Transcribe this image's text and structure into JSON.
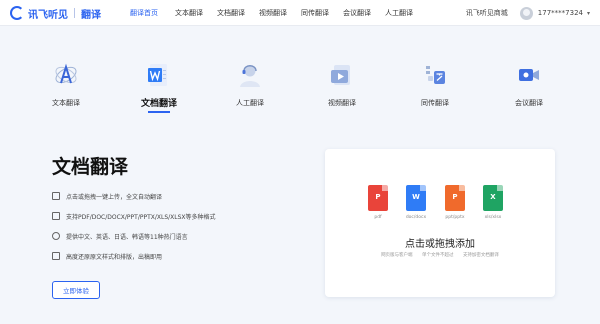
{
  "brand": {
    "name": "讯飞听见",
    "product": "翻译"
  },
  "nav": {
    "items": [
      {
        "label": "翻译首页",
        "active": true
      },
      {
        "label": "文本翻译",
        "active": false
      },
      {
        "label": "文档翻译",
        "active": false
      },
      {
        "label": "视频翻译",
        "active": false
      },
      {
        "label": "同传翻译",
        "active": false
      },
      {
        "label": "会议翻译",
        "active": false
      },
      {
        "label": "人工翻译",
        "active": false
      }
    ],
    "store_link": "讯飞听见商城",
    "username": "177****7324"
  },
  "feature_tabs": [
    {
      "label": "文本翻译",
      "icon": "text-translate-icon",
      "active": false
    },
    {
      "label": "文档翻译",
      "icon": "word-document-icon",
      "active": true
    },
    {
      "label": "人工翻译",
      "icon": "human-translator-icon",
      "active": false
    },
    {
      "label": "视频翻译",
      "icon": "video-icon",
      "active": false
    },
    {
      "label": "同传翻译",
      "icon": "simultaneous-interpretation-icon",
      "active": false
    },
    {
      "label": "会议翻译",
      "icon": "meeting-camera-icon",
      "active": false
    }
  ],
  "hero": {
    "title": "文档翻译",
    "features": [
      "点击或拖拽一键上传，全文自动翻译",
      "支持PDF/DOC/DOCX/PPT/PPTX/XLS/XLSX等多种格式",
      "提供中文、英语、日语、韩语等11种热门语言",
      "高度还原原文样式和排版，出稿即用"
    ],
    "cta": "立即体验"
  },
  "upload": {
    "file_types": [
      {
        "letter": "P",
        "caption": "pdf",
        "color": "#e9443a"
      },
      {
        "letter": "W",
        "caption": "doc/docx",
        "color": "#2f7cf6"
      },
      {
        "letter": "P",
        "caption": "ppt/pptx",
        "color": "#f06a2c"
      },
      {
        "letter": "X",
        "caption": "xls/xlsx",
        "color": "#1fa463"
      }
    ],
    "title": "点击或拖拽添加",
    "hints": [
      "网页版与客户端",
      "单个文件不超过",
      "支持加密文档翻译"
    ]
  },
  "colors": {
    "accent": "#2b63f0",
    "background": "#f3f6fb"
  }
}
